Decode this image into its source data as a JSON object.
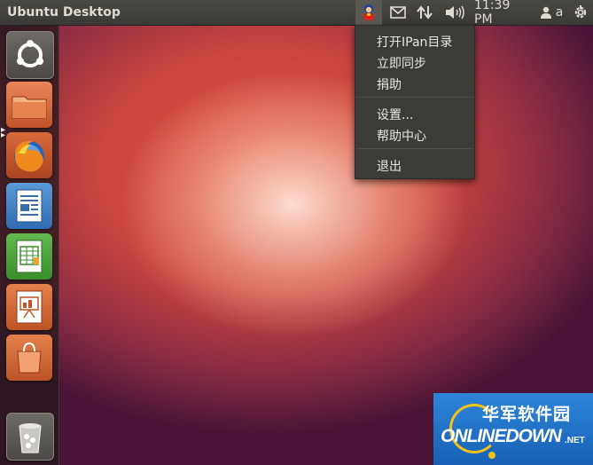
{
  "topbar": {
    "title": "Ubuntu Desktop",
    "clock": "11:39 PM",
    "user": "a"
  },
  "launcher": {
    "items": [
      {
        "name": "dash-home-button",
        "icon": "ubuntu-logo-icon"
      },
      {
        "name": "files-button",
        "icon": "folder-icon"
      },
      {
        "name": "firefox-button",
        "icon": "firefox-icon"
      },
      {
        "name": "libreoffice-writer-button",
        "icon": "writer-icon"
      },
      {
        "name": "libreoffice-calc-button",
        "icon": "calc-icon"
      },
      {
        "name": "libreoffice-impress-button",
        "icon": "impress-icon"
      },
      {
        "name": "software-center-button",
        "icon": "shopping-bag-icon"
      },
      {
        "name": "trash-button",
        "icon": "trash-icon"
      }
    ]
  },
  "menu": {
    "items": [
      "打开IPan目录",
      "立即同步",
      "捐助",
      "设置...",
      "帮助中心",
      "退出"
    ]
  },
  "watermark": {
    "cn": "华军软件园",
    "en": "ONLINEDOWN",
    "suffix": ".NET"
  },
  "colors": {
    "panel": "#3c3b37",
    "accent": "#dd4814",
    "text": "#dfdbd2"
  }
}
